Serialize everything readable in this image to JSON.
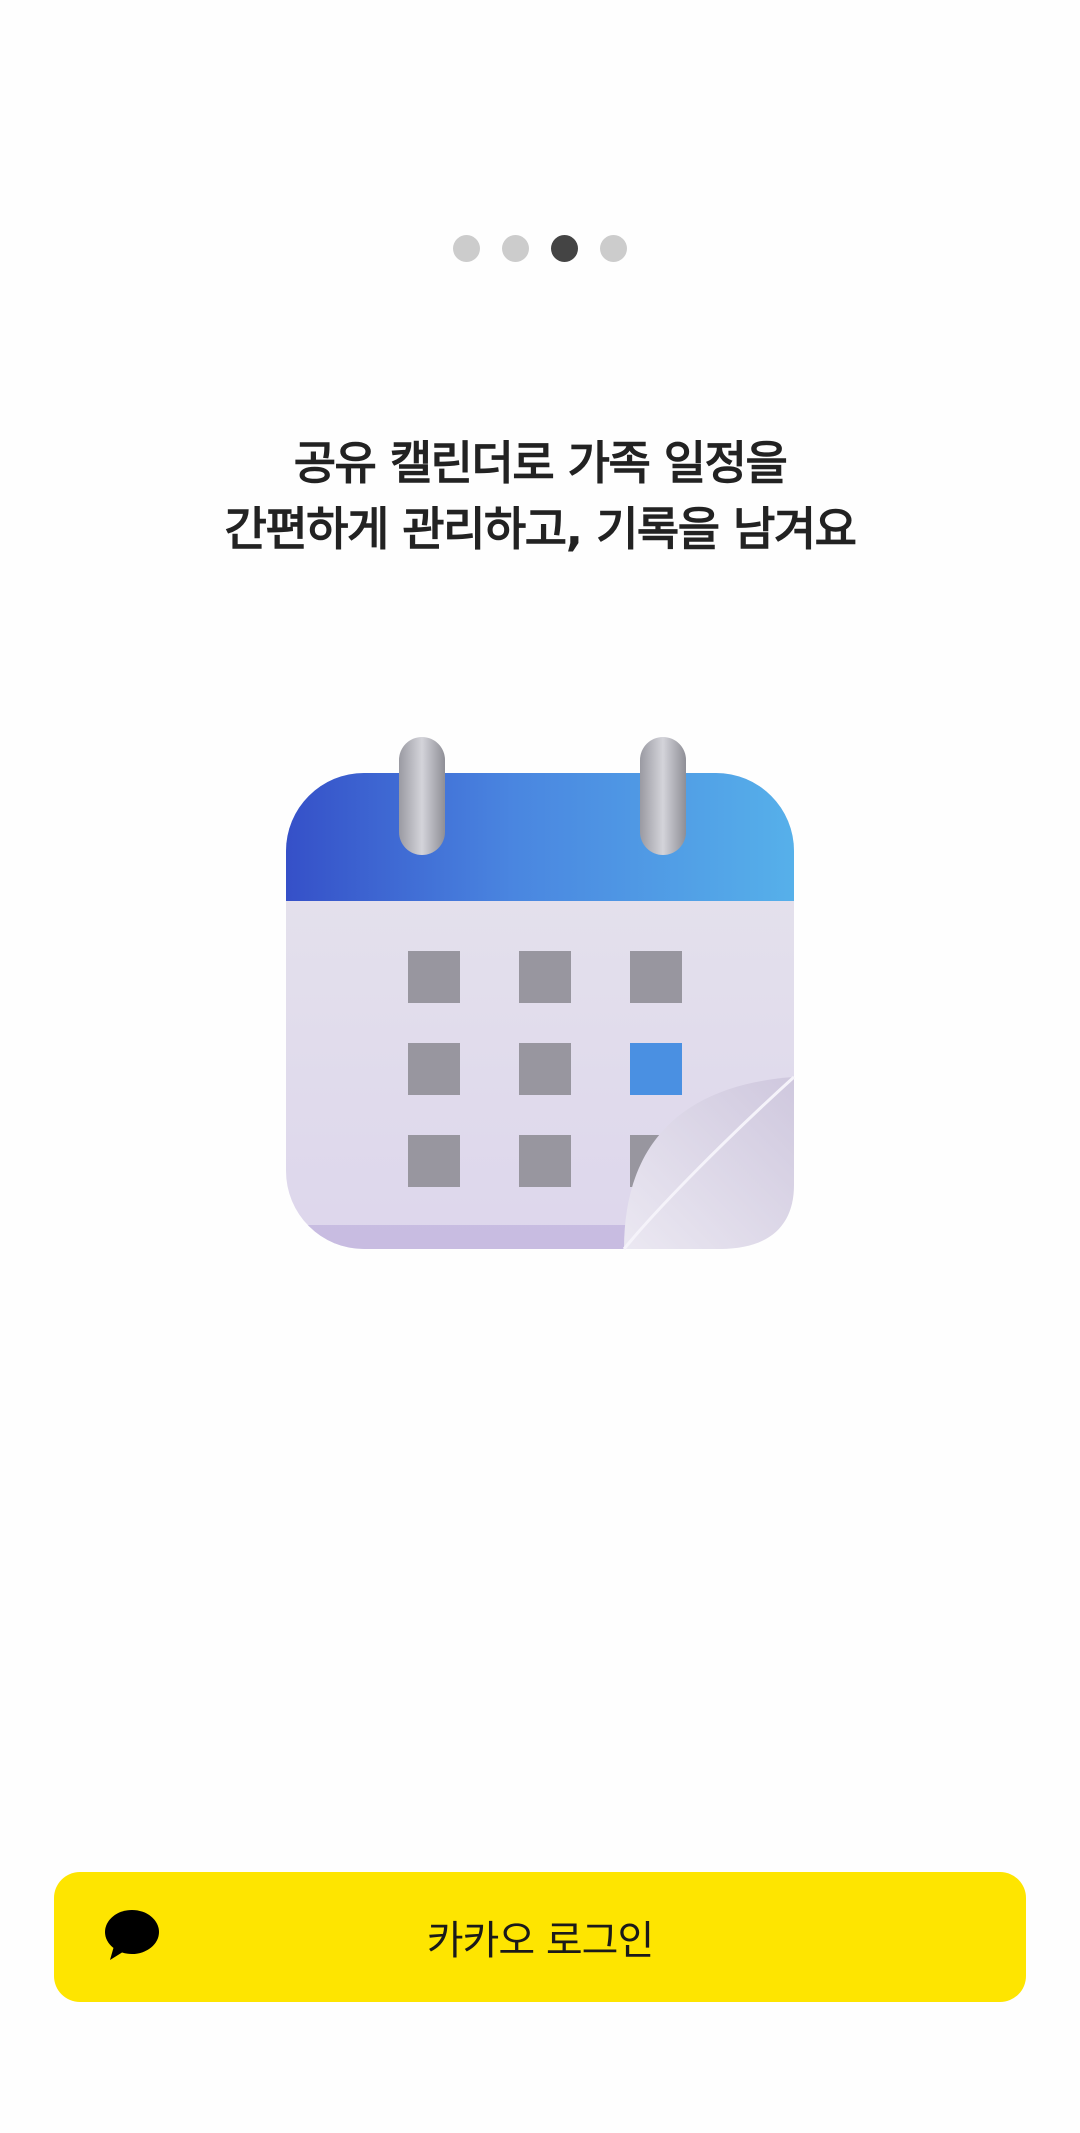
{
  "pager": {
    "total": 4,
    "active_index": 2
  },
  "onboarding": {
    "headline_line1": "공유 캘린더로 가족 일정을",
    "headline_line2": "간편하게 관리하고, 기록을 남겨요",
    "illustration": "calendar-icon"
  },
  "login": {
    "label": "카카오 로그인",
    "icon": "kakao-talk-bubble-icon",
    "background_color": "#FEE500",
    "text_color": "#1A1A1A"
  },
  "colors": {
    "pager_active": "#444444",
    "pager_inactive": "#CCCCCC",
    "calendar_header": "#3F7FDB",
    "calendar_highlight": "#4A90E2"
  }
}
